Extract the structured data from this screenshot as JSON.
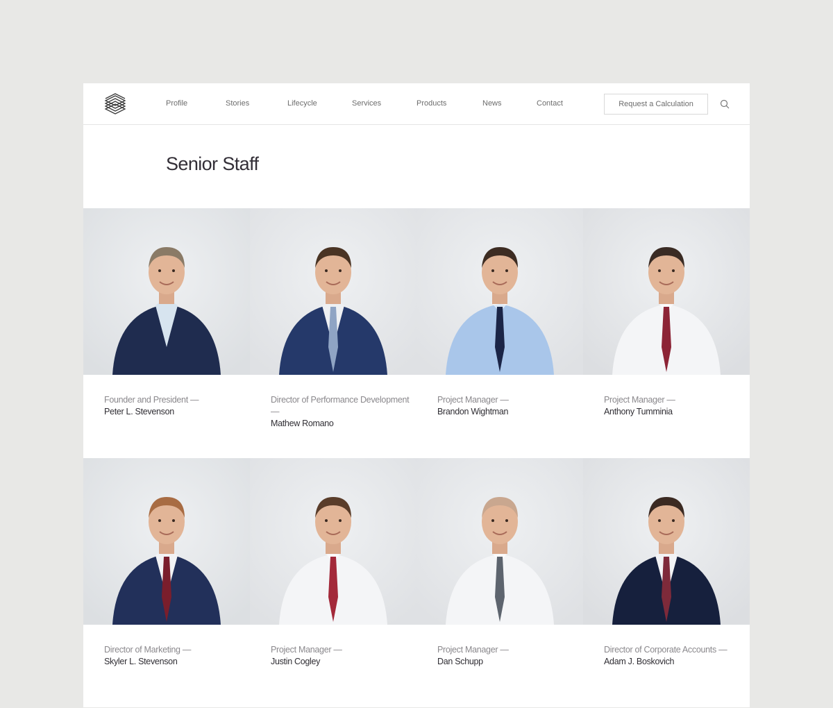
{
  "header": {
    "nav": [
      "Profile",
      "Stories",
      "Lifecycle",
      "Services",
      "Products",
      "News",
      "Contact"
    ],
    "cta_label": "Request a Calculation",
    "icons": {
      "logo": "stacked-lines-logo-icon",
      "search": "search-icon"
    }
  },
  "page_title": "Senior Staff",
  "staff": [
    {
      "role": "Founder and President —",
      "name": "Peter L. Stevenson",
      "suit": "#1f2c4f",
      "shirt": "#d7e4ef",
      "tie": "",
      "hair": "#8a7a66",
      "bg": "#dcdfe2"
    },
    {
      "role": "Director of Performance Development —",
      "name": "Mathew Romano",
      "suit": "#25396a",
      "shirt": "#eef0f3",
      "tie": "#8fa4c4",
      "hair": "#4a3424",
      "bg": "#dfe1e4"
    },
    {
      "role": "Project Manager —",
      "name": "Brandon Wightman",
      "suit": "",
      "shirt": "#a9c6ea",
      "tie": "#1b2547",
      "hair": "#3d2c22",
      "bg": "#dfe1e4"
    },
    {
      "role": "Project Manager —",
      "name": "Anthony Tumminia",
      "suit": "",
      "shirt": "#f4f5f7",
      "tie": "#8c2436",
      "hair": "#3a2b24",
      "bg": "#dcdee1"
    },
    {
      "role": "Director of Marketing —",
      "name": "Skyler L. Stevenson",
      "suit": "#22305a",
      "shirt": "#f2f3f5",
      "tie": "#7a1e2c",
      "hair": "#a86c43",
      "bg": "#dcdfe2"
    },
    {
      "role": "Project Manager —",
      "name": "Justin Cogley",
      "suit": "",
      "shirt": "#f4f5f7",
      "tie": "#a3293a",
      "hair": "#5a3d2a",
      "bg": "#dfe1e4"
    },
    {
      "role": "Project Manager —",
      "name": "Dan Schupp",
      "suit": "",
      "shirt": "#f4f5f7",
      "tie": "#5d646e",
      "hair": "#c9a78f",
      "bg": "#dfe1e4"
    },
    {
      "role": "Director of Corporate Accounts —",
      "name": "Adam J. Boskovich",
      "suit": "#16203d",
      "shirt": "#f2f3f5",
      "tie": "#7e2a3a",
      "hair": "#3b2a22",
      "bg": "#dcdee1"
    }
  ],
  "colors": {
    "background": "#e8e8e6",
    "panel": "#ffffff",
    "text": "#2f2d33",
    "muted": "#8a888c"
  }
}
